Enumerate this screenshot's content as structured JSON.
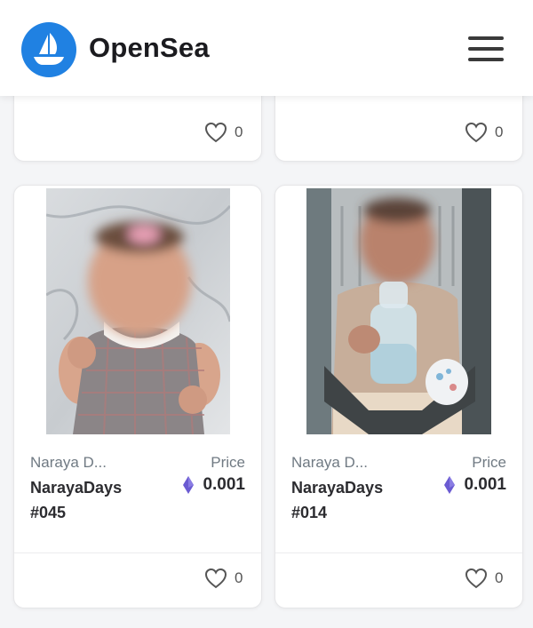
{
  "header": {
    "brand": "OpenSea",
    "logo_icon": "sailboat-icon",
    "menu_icon": "hamburger-menu-icon",
    "logo_color": "#2081e2"
  },
  "top_cards": [
    {
      "likes": "0"
    },
    {
      "likes": "0"
    }
  ],
  "items": [
    {
      "collection": "Naraya D...",
      "name_line1": "NarayaDays",
      "name_line2": "#045",
      "price_label": "Price",
      "price": "0.001",
      "likes": "0"
    },
    {
      "collection": "Naraya D...",
      "name_line1": "NarayaDays",
      "name_line2": "#014",
      "price_label": "Price",
      "price": "0.001",
      "likes": "0"
    }
  ],
  "colors": {
    "eth_purple": "#6b5bd2",
    "text_dark": "#2c2c30",
    "text_muted": "#707a83"
  }
}
